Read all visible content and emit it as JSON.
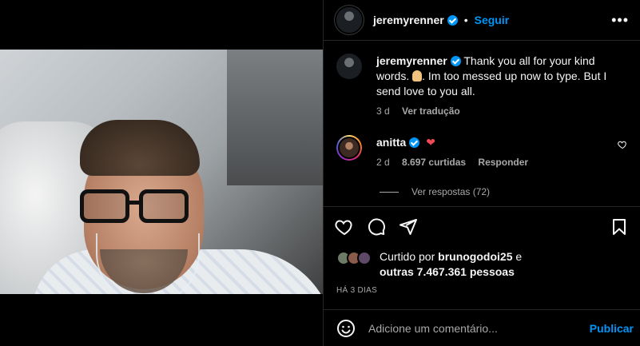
{
  "post": {
    "username": "jeremyrenner",
    "follow_label": "Seguir",
    "separator": "•",
    "more_label": "•••"
  },
  "caption": {
    "username": "jeremyrenner",
    "text_before": "Thank you all for your kind words.",
    "emoji_icon": "praying-hands-icon",
    "text_after": ". Im too messed up now to type. But I send love to you all.",
    "age": "3 d",
    "translate_label": "Ver tradução"
  },
  "comment": {
    "username": "anitta",
    "text": "❤",
    "age": "2 d",
    "likes": "8.697 curtidas",
    "reply_label": "Responder",
    "view_replies": "Ver respostas (72)"
  },
  "likes": {
    "prefix": "Curtido por ",
    "user": "brunogodoi25",
    "connector": " e",
    "others": "outras 7.467.361 pessoas"
  },
  "date_label": "HÁ 3 DIAS",
  "add_comment": {
    "placeholder": "Adicione um comentário...",
    "post_label": "Publicar"
  },
  "colors": {
    "accent": "#0095f6",
    "heart": "#ed4956",
    "muted": "#a8a8a8",
    "background": "#000000"
  },
  "icons": [
    "heart-icon",
    "comment-icon",
    "share-icon",
    "bookmark-icon",
    "emoji-icon",
    "more-icon",
    "verified-icon"
  ]
}
